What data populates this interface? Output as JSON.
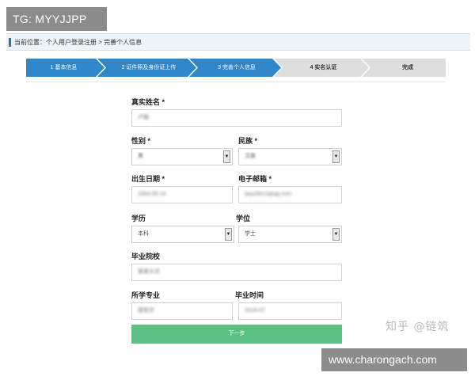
{
  "overlay_tag": "TG: MYYJJPP",
  "breadcrumb": "当前位置：个人用户登录注册 > 完善个人信息",
  "steps": [
    {
      "label": "1 基本信息",
      "active": true
    },
    {
      "label": "2 证件照及身份证上传",
      "active": true
    },
    {
      "label": "3 完善个人信息",
      "active": true
    },
    {
      "label": "4 实名认证",
      "active": false
    },
    {
      "label": "完成",
      "active": false
    }
  ],
  "colors": {
    "step_active": "#2f86c9",
    "step_inactive": "#dedede",
    "button": "#5cc085"
  },
  "form": {
    "real_name_label": "真实姓名 *",
    "real_name_value": "卢雅",
    "gender_label": "性别 *",
    "gender_value": "男",
    "ethnicity_label": "民族 *",
    "ethnicity_value": "汉族",
    "birth_label": "出生日期 *",
    "birth_value": "1994-05-16",
    "email_label": "电子邮箱 *",
    "email_value": "lwyz0812@qq.com",
    "education_label": "学历",
    "education_value": "本科",
    "degree_label": "学位",
    "degree_value": "学士",
    "school_label": "毕业院校",
    "school_value": "某某大学",
    "major_label": "所学专业",
    "major_value": "建筑学",
    "grad_time_label": "毕业时间",
    "grad_time_value": "2016-07",
    "next_button": "下一步",
    "dropdown_arrow": "▼"
  },
  "watermark": "知乎 @链筑",
  "overlay_url": "www.charongach.com"
}
